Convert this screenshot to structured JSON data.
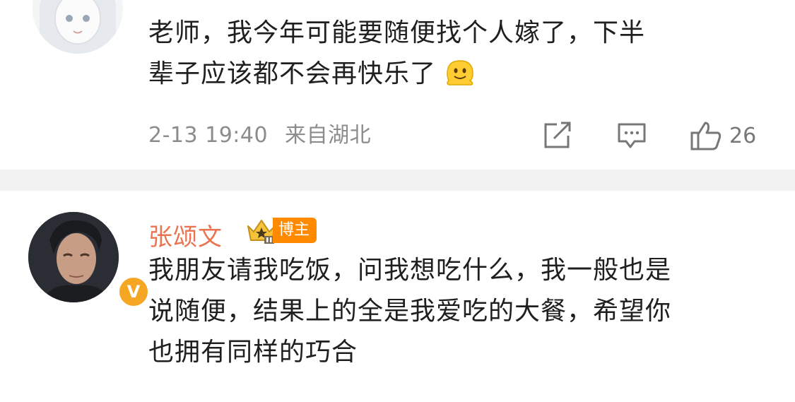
{
  "comment1": {
    "avatar": "anime-girl-avatar",
    "text_line1": "老师，我今年可能要随便找个人嫁了，下半",
    "text_line2": "辈子应该都不会再快乐了",
    "emoji": "melting-face-emoji",
    "time": "2-13 19:40",
    "location": "来自湖北",
    "like_count": "26"
  },
  "comment2": {
    "avatar": "man-portrait-avatar",
    "username": "张颂文",
    "badge_label": "博主",
    "verified_label": "V",
    "text_line1": "我朋友请我吃饭，问我想吃什么，我一般也是",
    "text_line2": "说随便，结果上的全是我爱吃的大餐，希望你",
    "text_line3": "也拥有同样的巧合"
  },
  "colors": {
    "username": "#eb7350",
    "meta": "#8c8c8c",
    "badge": "#ff8a00",
    "separator": "#f2f2f2"
  }
}
